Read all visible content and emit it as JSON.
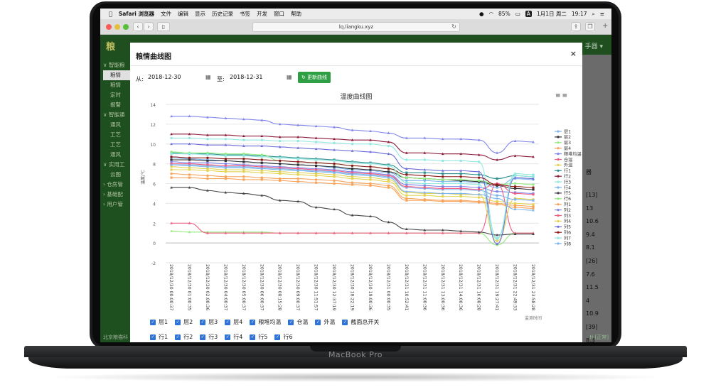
{
  "menubar": {
    "app": "Safari 浏览器",
    "items": [
      "文件",
      "编辑",
      "显示",
      "历史记录",
      "书签",
      "开发",
      "窗口",
      "帮助"
    ],
    "battery": "85%",
    "input_icon": "A",
    "date": "1月1日 周二",
    "time": "19:17"
  },
  "browser": {
    "url": "lq.liangku.xyz"
  },
  "app": {
    "logo": "粮",
    "header_right": "手器 ▾",
    "sidebar": [
      "∨ 智能粮",
      "粮情",
      "粮情",
      "定时",
      "报警",
      "∨ 智能通",
      "通风",
      "工艺",
      "工艺",
      "通风",
      "∨ 实用工",
      "云图",
      "› 仓房管",
      "› 基础配",
      "› 用户管"
    ],
    "right_header": "器",
    "right_values": [
      "[13]",
      "13",
      "10.6",
      "9.4",
      "8.1",
      "[26]",
      "7.6",
      "11.5",
      "4",
      "10.9",
      "[39]",
      "8.3",
      "4.6",
      "9.2"
    ],
    "footer_left": "北京粮猫科",
    "footer_right": "ti [正常]"
  },
  "modal": {
    "title": "粮情曲线图",
    "close": "×",
    "from_label": "从:",
    "from_value": "2018-12-30",
    "to_label": "至:",
    "to_value": "2018-12-31",
    "update_button": "更新曲线",
    "chart_menu": "≡≡",
    "checkbox_rows": [
      [
        "层1",
        "层2",
        "层3",
        "层4",
        "粮堆均温",
        "仓温",
        "外温",
        "截面总开关"
      ],
      [
        "行1",
        "行2",
        "行3",
        "行4",
        "行5",
        "行6"
      ],
      [
        "列1",
        "列2",
        "列3",
        "列4",
        "列5",
        "列6",
        "列7",
        "列8"
      ]
    ]
  },
  "chart_data": {
    "type": "line",
    "title": "温度曲线图",
    "ylabel": "温度/℃",
    "xlabel": "监测时间",
    "ylim": [
      -2,
      14
    ],
    "yticks": [
      -2,
      0,
      2,
      4,
      6,
      8,
      10,
      12,
      14
    ],
    "categories": [
      "2018/12/30 00:00:37",
      "2018/12/30 01:00:35",
      "2018/12/30 02:00:36",
      "2018/12/30 04:00:37",
      "2018/12/30 05:00:37",
      "2018/12/30 06:00:37",
      "2018/12/30 08:15:28",
      "2018/12/30 09:00:37",
      "2018/12/30 11:51:57",
      "2018/12/30 12:37:19",
      "2018/12/30 18:22:19",
      "2018/12/30 19:00:36",
      "2018/12/31 00:00:35",
      "2018/12/31 10:52:41",
      "2018/12/31 11:00:36",
      "2018/12/31 13:00:36",
      "2018/12/31 14:00:36",
      "2018/12/31 16:08:28",
      "2018/12/31 19:27:41",
      "2018/12/31 22:49:33",
      "2018/12/31 23:58:28"
    ],
    "legend_position": "right",
    "grid": true,
    "series": [
      {
        "name": "层1",
        "color": "#7cb5ec",
        "values": [
          8.6,
          8.5,
          8.4,
          8.3,
          8.2,
          8.1,
          8.0,
          7.9,
          7.8,
          7.6,
          7.4,
          7.3,
          7.1,
          6.3,
          6.3,
          6.2,
          6.2,
          6.1,
          5.6,
          6.5,
          6.4
        ]
      },
      {
        "name": "层2",
        "color": "#333333",
        "values": [
          8.4,
          8.4,
          8.3,
          8.3,
          8.2,
          8.1,
          8.0,
          7.9,
          7.8,
          7.7,
          7.5,
          7.4,
          7.2,
          6.6,
          6.5,
          6.4,
          6.3,
          6.2,
          5.8,
          5.5,
          5.4
        ]
      },
      {
        "name": "层3",
        "color": "#90ed7d",
        "values": [
          1.2,
          1.1,
          1.1,
          1.1,
          1.1,
          1.1,
          1.0,
          1.0,
          1.0,
          1.0,
          1.0,
          1.0,
          1.0,
          1.0,
          1.0,
          1.0,
          1.0,
          1.0,
          -0.2,
          1.0,
          1.0
        ]
      },
      {
        "name": "层4",
        "color": "#f7a35c",
        "values": [
          7.0,
          6.9,
          6.8,
          6.7,
          6.7,
          6.6,
          6.5,
          6.5,
          6.4,
          6.3,
          6.1,
          6.0,
          5.8,
          4.5,
          4.4,
          4.3,
          4.3,
          4.2,
          4.0,
          3.8,
          3.7
        ]
      },
      {
        "name": "粮堆均温",
        "color": "#8085e9",
        "values": [
          8.2,
          8.1,
          8.1,
          8.0,
          7.9,
          7.8,
          7.7,
          7.6,
          7.5,
          7.4,
          7.2,
          7.1,
          6.9,
          5.9,
          5.8,
          5.7,
          5.7,
          5.6,
          5.2,
          5.1,
          5.0
        ]
      },
      {
        "name": "仓温",
        "color": "#f15c80",
        "values": [
          2.0,
          2.0,
          1.0,
          1.0,
          1.0,
          1.0,
          1.0,
          1.0,
          1.0,
          1.0,
          1.0,
          1.0,
          1.0,
          1.0,
          1.0,
          1.0,
          1.0,
          1.0,
          6.0,
          1.0,
          1.0
        ]
      },
      {
        "name": "外温",
        "color": "#e4d354",
        "values": [
          7.7,
          7.6,
          7.5,
          7.4,
          7.4,
          7.3,
          7.2,
          7.1,
          7.0,
          6.9,
          6.7,
          6.6,
          6.4,
          5.1,
          5.0,
          5.0,
          4.9,
          4.9,
          0.2,
          4.5,
          4.4
        ]
      },
      {
        "name": "行1",
        "color": "#2b908f",
        "values": [
          9.1,
          9.0,
          9.0,
          8.9,
          8.9,
          8.8,
          8.7,
          8.6,
          8.5,
          8.4,
          8.2,
          8.1,
          7.9,
          7.1,
          7.1,
          7.0,
          7.0,
          6.9,
          6.5,
          6.8,
          6.7
        ]
      },
      {
        "name": "行2",
        "color": "#8b1a3a",
        "values": [
          11.0,
          11.0,
          10.9,
          10.9,
          10.8,
          10.8,
          10.7,
          10.7,
          10.6,
          10.5,
          10.4,
          10.4,
          10.2,
          9.1,
          9.1,
          9.0,
          9.0,
          8.9,
          8.4,
          8.8,
          8.7
        ]
      },
      {
        "name": "行3",
        "color": "#91e8e1",
        "values": [
          10.6,
          10.6,
          10.5,
          10.5,
          10.4,
          10.4,
          10.3,
          10.3,
          10.2,
          10.1,
          10.0,
          10.0,
          9.8,
          8.4,
          8.4,
          8.3,
          8.3,
          8.2,
          0.5,
          7.0,
          6.9
        ]
      },
      {
        "name": "行4",
        "color": "#7cb5ec",
        "values": [
          7.9,
          7.9,
          7.8,
          7.7,
          7.7,
          7.6,
          7.5,
          7.4,
          7.3,
          7.2,
          7.0,
          6.9,
          6.7,
          5.6,
          5.5,
          5.4,
          5.4,
          5.3,
          4.8,
          4.4,
          4.3
        ]
      },
      {
        "name": "行5",
        "color": "#434348",
        "values": [
          5.6,
          5.6,
          5.3,
          5.1,
          5.0,
          4.8,
          4.3,
          4.2,
          3.6,
          3.4,
          2.8,
          2.7,
          2.1,
          1.4,
          1.3,
          1.3,
          1.2,
          1.1,
          0.8,
          0.9,
          0.9
        ]
      },
      {
        "name": "行6",
        "color": "#90ed7d",
        "values": [
          9.2,
          9.1,
          9.1,
          9.0,
          9.0,
          8.9,
          8.3,
          8.2,
          8.1,
          8.0,
          7.8,
          7.7,
          7.5,
          6.6,
          6.5,
          6.4,
          6.4,
          6.3,
          5.9,
          6.0,
          5.9
        ]
      },
      {
        "name": "列1",
        "color": "#f7a35c",
        "values": [
          6.6,
          6.6,
          6.5,
          6.5,
          6.4,
          6.4,
          6.3,
          6.2,
          6.1,
          6.0,
          5.9,
          5.8,
          5.6,
          4.3,
          4.3,
          4.2,
          4.2,
          4.1,
          3.9,
          3.6,
          3.5
        ]
      },
      {
        "name": "列2",
        "color": "#8085e9",
        "values": [
          12.8,
          12.8,
          12.7,
          12.6,
          12.5,
          12.4,
          12.0,
          11.9,
          11.8,
          11.7,
          11.4,
          11.3,
          11.1,
          10.6,
          10.6,
          10.5,
          10.5,
          10.4,
          9.1,
          10.3,
          10.2
        ]
      },
      {
        "name": "列3",
        "color": "#f15c80",
        "values": [
          8.0,
          8.0,
          7.9,
          7.8,
          7.8,
          7.7,
          7.6,
          7.5,
          7.4,
          7.3,
          7.1,
          7.0,
          6.8,
          5.7,
          5.6,
          5.5,
          5.5,
          5.4,
          6.0,
          5.0,
          4.9
        ]
      },
      {
        "name": "列4",
        "color": "#e4d354",
        "values": [
          7.4,
          7.4,
          7.3,
          7.2,
          7.2,
          7.1,
          7.0,
          6.9,
          6.8,
          6.7,
          6.5,
          6.4,
          6.2,
          4.8,
          4.8,
          4.7,
          4.7,
          4.6,
          4.2,
          4.0,
          3.9
        ]
      },
      {
        "name": "列5",
        "color": "#6b6bd9",
        "values": [
          10.0,
          10.0,
          9.9,
          9.9,
          9.8,
          9.8,
          9.7,
          9.6,
          9.5,
          9.4,
          9.3,
          9.2,
          9.0,
          7.5,
          7.4,
          7.3,
          7.3,
          7.2,
          -0.1,
          6.6,
          6.5
        ]
      },
      {
        "name": "列6",
        "color": "#8b1a1a",
        "values": [
          8.7,
          8.6,
          8.6,
          8.5,
          8.5,
          8.4,
          8.3,
          8.2,
          8.1,
          8.0,
          7.8,
          7.7,
          7.5,
          6.9,
          6.8,
          6.7,
          6.7,
          6.6,
          5.9,
          5.7,
          5.6
        ]
      },
      {
        "name": "列7",
        "color": "#91e8e1",
        "values": [
          9.0,
          9.0,
          8.9,
          8.8,
          8.8,
          8.7,
          8.6,
          8.5,
          8.4,
          8.3,
          8.1,
          8.0,
          7.8,
          6.1,
          6.0,
          6.0,
          6.0,
          5.9,
          0.4,
          6.8,
          6.7
        ]
      },
      {
        "name": "列8",
        "color": "#7cb5ec",
        "values": [
          7.9,
          7.8,
          7.7,
          7.6,
          7.6,
          7.5,
          7.4,
          7.3,
          7.2,
          7.1,
          6.9,
          6.8,
          6.6,
          5.2,
          5.1,
          5.0,
          5.0,
          4.9,
          4.5,
          3.4,
          3.3
        ]
      }
    ]
  }
}
